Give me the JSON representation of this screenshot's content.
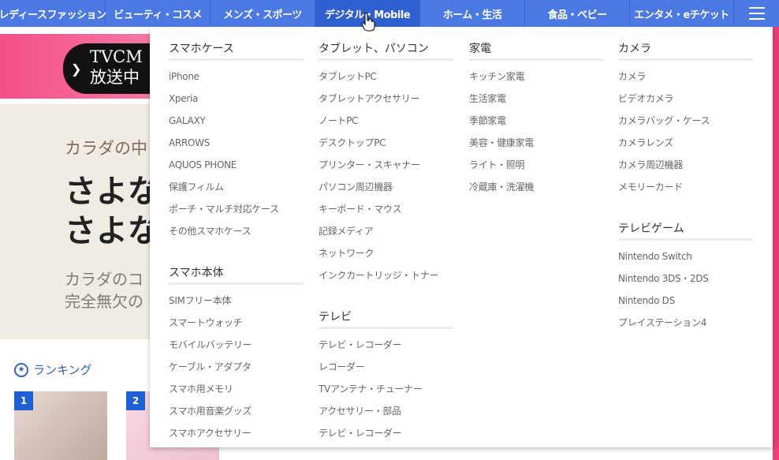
{
  "nav": {
    "items": [
      {
        "label": "レディースファッション"
      },
      {
        "label": "ビューティ・コスメ"
      },
      {
        "label": "メンズ・スポーツ"
      },
      {
        "label": "デジタル・Mobile"
      },
      {
        "label": "ホーム・生活"
      },
      {
        "label": "食品・ベビー"
      },
      {
        "label": "エンタメ・eチケット"
      }
    ],
    "menu_icon": "hamburger-icon",
    "active_index": 3
  },
  "background": {
    "tv_badge": {
      "line1": "TVCM",
      "line2": "放送中"
    },
    "hero": {
      "sub1": "カラダの中",
      "big1": "さよな",
      "big2": "さよな",
      "sub2a": "カラダのコ",
      "sub2b": "完全無欠の"
    },
    "ranking": {
      "label": "ランキング",
      "icon": "star-icon",
      "items": [
        {
          "rank": "1"
        },
        {
          "rank": "2"
        }
      ]
    }
  },
  "mega_menu": {
    "col1": {
      "sections": [
        {
          "title": "スマホケース",
          "items": [
            "iPhone",
            "Xperia",
            "GALAXY",
            "ARROWS",
            "AQUOS PHONE",
            "保護フィルム",
            "ポーチ・マルチ対応ケース",
            "その他スマホケース"
          ]
        },
        {
          "title": "スマホ本体",
          "items": [
            "SIMフリー本体",
            "スマートウォッチ",
            "モバイルバッテリー",
            "ケーブル・アダプタ",
            "スマホ用メモリ",
            "スマホ用音楽グッズ",
            "スマホアクセサリー"
          ]
        }
      ]
    },
    "col2": {
      "sections": [
        {
          "title": "タブレット、パソコン",
          "items": [
            "タブレットPC",
            "タブレットアクセサリー",
            "ノートPC",
            "デスクトップPC",
            "プリンター・スキャナー",
            "パソコン周辺機器",
            "キーボード・マウス",
            "記録メディア",
            "ネットワーク",
            "インクカートリッジ・トナー"
          ]
        },
        {
          "title": "テレビ",
          "items": [
            "テレビ・レコーダー",
            "レコーダー",
            "TVアンテナ・チューナー",
            "アクセサリー・部品",
            "テレビ・レコーダー"
          ]
        }
      ]
    },
    "col3": {
      "sections": [
        {
          "title": "家電",
          "items": [
            "キッチン家電",
            "生活家電",
            "季節家電",
            "美容・健康家電",
            "ライト・照明",
            "冷蔵庫・洗濯機"
          ]
        }
      ]
    },
    "col4": {
      "sections": [
        {
          "title": "カメラ",
          "items": [
            "カメラ",
            "ビデオカメラ",
            "カメラバッグ・ケース",
            "カメラレンズ",
            "カメラ周辺機器",
            "メモリーカード"
          ]
        },
        {
          "title": "テレビゲーム",
          "items": [
            "Nintendo Switch",
            "Nintendo 3DS・2DS",
            "Nintendo DS",
            "プレイステーション4"
          ]
        }
      ]
    }
  },
  "colors": {
    "nav_bg": "#4a79e4",
    "nav_active": "#2f5fd1",
    "link_blue": "#3560c4",
    "banner_pink": "#f44f87"
  }
}
